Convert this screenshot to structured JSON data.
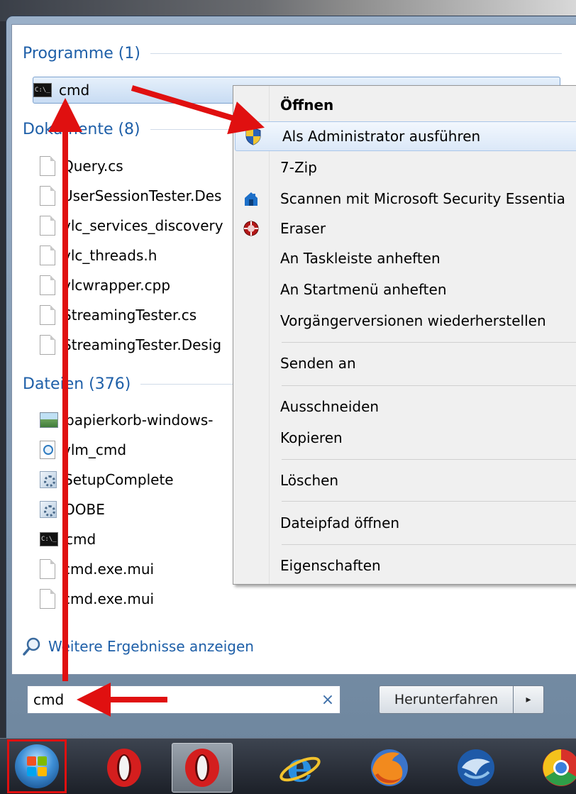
{
  "groups": {
    "programs": {
      "header": "Programme (1)",
      "items": [
        {
          "label": "cmd",
          "icon": "cmd-icon"
        }
      ]
    },
    "documents": {
      "header": "Dokumente (8)",
      "items": [
        {
          "label": "Query.cs"
        },
        {
          "label": "UserSessionTester.Des"
        },
        {
          "label": "vlc_services_discovery"
        },
        {
          "label": "vlc_threads.h"
        },
        {
          "label": "vlcwrapper.cpp"
        },
        {
          "label": "StreamingTester.cs"
        },
        {
          "label": "StreamingTester.Desig"
        }
      ]
    },
    "files": {
      "header": "Dateien (376)",
      "items": [
        {
          "label": "papierkorb-windows-",
          "icon": "image-file-icon"
        },
        {
          "label": "vlm_cmd",
          "icon": "xml-file-icon"
        },
        {
          "label": "SetupComplete",
          "icon": "settings-file-icon"
        },
        {
          "label": "OOBE",
          "icon": "settings-file-icon"
        },
        {
          "label": "cmd",
          "icon": "cmd-icon"
        },
        {
          "label": "cmd.exe.mui",
          "icon": "document-icon"
        },
        {
          "label": "cmd.exe.mui",
          "icon": "document-icon"
        }
      ]
    }
  },
  "more_results": "Weitere Ergebnisse anzeigen",
  "search": {
    "value": "cmd",
    "clear_symbol": "×"
  },
  "shutdown": {
    "label": "Herunterfahren",
    "arrow_symbol": "▸"
  },
  "context_menu": {
    "items": [
      {
        "label": "Öffnen",
        "bold": true
      },
      {
        "label": "Als Administrator ausführen",
        "icon": "uac-shield-icon",
        "highlighted": true
      },
      {
        "label": "7-Zip"
      },
      {
        "label": "Scannen mit Microsoft Security Essentia",
        "icon": "security-essentials-icon"
      },
      {
        "label": "Eraser",
        "icon": "eraser-icon"
      },
      {
        "label": "An Taskleiste anheften"
      },
      {
        "label": "An Startmenü anheften"
      },
      {
        "label": "Vorgängerversionen wiederherstellen"
      },
      {
        "label": "Senden an"
      },
      {
        "label": "Ausschneiden"
      },
      {
        "label": "Kopieren"
      },
      {
        "label": "Löschen"
      },
      {
        "label": "Dateipfad öffnen"
      },
      {
        "label": "Eigenschaften"
      }
    ]
  },
  "taskbar": {
    "apps": [
      {
        "name": "opera-icon"
      },
      {
        "name": "opera-icon",
        "active": true
      },
      {
        "name": "internet-explorer-icon"
      },
      {
        "name": "firefox-icon"
      },
      {
        "name": "thunderbird-icon"
      },
      {
        "name": "chrome-icon"
      }
    ]
  },
  "colors": {
    "accent_blue": "#1e5fa8",
    "annotation_red": "#e01010",
    "selection": "#c8dcf3"
  }
}
